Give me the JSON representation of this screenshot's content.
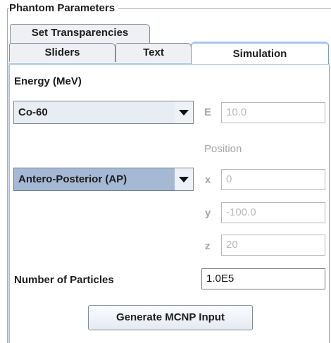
{
  "panel": {
    "title": "Phantom Parameters"
  },
  "tabs": [
    {
      "label": "Set Transparencies",
      "selected": false
    },
    {
      "label": "Sliders",
      "selected": false
    },
    {
      "label": "Text",
      "selected": false
    },
    {
      "label": "Simulation",
      "selected": true
    }
  ],
  "simulation": {
    "energy_label": "Energy (MeV)",
    "source_select": {
      "value": "Co-60"
    },
    "energy_field": {
      "label": "E",
      "value": "10.0"
    },
    "position_label": "Position",
    "direction_select": {
      "value": "Antero-Posterior (AP)"
    },
    "position_x": {
      "label": "x",
      "value": "0"
    },
    "position_y": {
      "label": "y",
      "value": "-100.0"
    },
    "position_z": {
      "label": "z",
      "value": "20"
    },
    "particles": {
      "label": "Number of Particles",
      "value": "1.0E5"
    },
    "generate_button": "Generate MCNP Input"
  },
  "colors": {
    "selected_combo_bg": "#a5b8d4",
    "tab_accent": "#a7c5ee",
    "disabled_text": "#a6a6a6"
  }
}
